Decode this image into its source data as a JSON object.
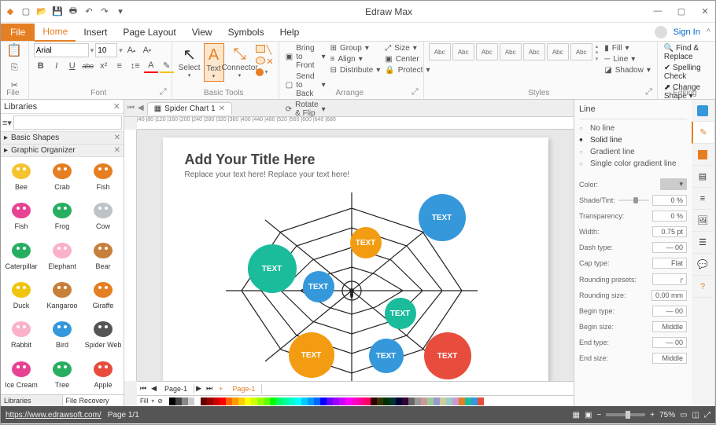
{
  "app_title": "Edraw Max",
  "menus": {
    "file": "File",
    "home": "Home",
    "insert": "Insert",
    "page_layout": "Page Layout",
    "view": "View",
    "symbols": "Symbols",
    "help": "Help"
  },
  "signin": "Sign In",
  "ribbon": {
    "file_label": "File",
    "font": {
      "label": "Font",
      "name": "Arial",
      "size": "10",
      "bold": "B",
      "italic": "I",
      "underline": "U",
      "strike": "abc"
    },
    "basic_tools": {
      "label": "Basic Tools",
      "select": "Select",
      "text": "Text",
      "connector": "Connector"
    },
    "arrange": {
      "label": "Arrange",
      "bring_front": "Bring to Front",
      "send_back": "Send to Back",
      "rotate_flip": "Rotate & Flip",
      "group": "Group",
      "align": "Align",
      "distribute": "Distribute",
      "size": "Size",
      "center": "Center",
      "protect": "Protect"
    },
    "styles": {
      "label": "Styles",
      "sample": "Abc",
      "fill": "Fill",
      "line": "Line",
      "shadow": "Shadow"
    },
    "editing": {
      "label": "Editing",
      "find_replace": "Find & Replace",
      "spelling": "Spelling Check",
      "change_shape": "Change Shape"
    }
  },
  "left": {
    "title": "Libraries",
    "basic_shapes": "Basic Shapes",
    "graphic_organizer": "Graphic Organizer",
    "bottom_tabs": {
      "libraries": "Libraries",
      "file_recovery": "File Recovery"
    },
    "shapes": [
      {
        "name": "Bee",
        "color": "#f4c430"
      },
      {
        "name": "Crab",
        "color": "#e67e22"
      },
      {
        "name": "Fish",
        "color": "#e67e22"
      },
      {
        "name": "Fish",
        "color": "#e84393"
      },
      {
        "name": "Frog",
        "color": "#27ae60"
      },
      {
        "name": "Cow",
        "color": "#bdc3c7"
      },
      {
        "name": "Caterpillar",
        "color": "#27ae60"
      },
      {
        "name": "Elephant",
        "color": "#fab1c9"
      },
      {
        "name": "Bear",
        "color": "#c87f3a"
      },
      {
        "name": "Duck",
        "color": "#f1c40f"
      },
      {
        "name": "Kangaroo",
        "color": "#c87f3a"
      },
      {
        "name": "Giraffe",
        "color": "#e67e22"
      },
      {
        "name": "Rabbit",
        "color": "#fab1c9"
      },
      {
        "name": "Bird",
        "color": "#3498db"
      },
      {
        "name": "Spider Web",
        "color": "#555"
      },
      {
        "name": "Ice Cream",
        "color": "#e84393"
      },
      {
        "name": "Tree",
        "color": "#27ae60"
      },
      {
        "name": "Apple",
        "color": "#e74c3c"
      }
    ]
  },
  "canvas": {
    "tab_title": "Spider Chart 1",
    "title": "Add Your Title Here",
    "subtitle": "Replace your text here!   Replace your text here!",
    "bubble_text": "TEXT",
    "page_tab1": "Page-1",
    "page_tab2": "Page-1",
    "fill_label": "Fill"
  },
  "right": {
    "title": "Line",
    "no_line": "No line",
    "solid": "Solid line",
    "gradient": "Gradient line",
    "single_gradient": "Single color gradient line",
    "color": "Color:",
    "shade": "Shade/Tint:",
    "shade_val": "0 %",
    "transparency": "Transparency:",
    "transparency_val": "0 %",
    "width": "Width:",
    "width_val": "0.75 pt",
    "dash": "Dash type:",
    "dash_val": "00",
    "cap": "Cap type:",
    "cap_val": "Flat",
    "rounding_presets": "Rounding presets:",
    "rounding_size": "Rounding size:",
    "rounding_size_val": "0.00 mm",
    "begin_type": "Begin type:",
    "begin_type_val": "00",
    "begin_size": "Begin size:",
    "begin_size_val": "Middle",
    "end_type": "End type:",
    "end_type_val": "00",
    "end_size": "End size:",
    "end_size_val": "Middle"
  },
  "status": {
    "url": "https://www.edrawsoft.com/",
    "page": "Page 1/1",
    "zoom": "75%"
  },
  "ruler_ticks": [
    "      ",
    "|40",
    "|80",
    "|120",
    "|160",
    "|200",
    "|240",
    "|280",
    "|320",
    "|360",
    "|400",
    "|440",
    "|480",
    "|520",
    "|560",
    "|600",
    "|640",
    "|680"
  ]
}
